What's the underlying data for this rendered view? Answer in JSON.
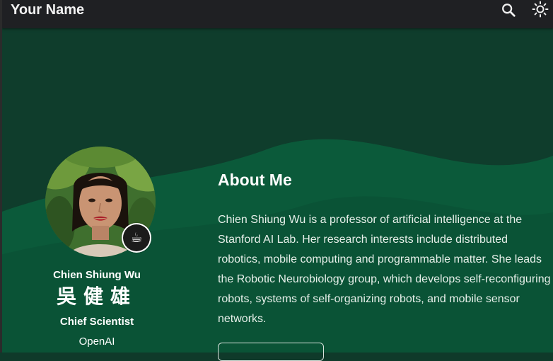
{
  "header": {
    "brand": "Your Name",
    "search_icon": "search-icon",
    "theme_icon": "sun-icon"
  },
  "profile": {
    "name_en": "Chien Shiung Wu",
    "name_cn": "吳健雄",
    "role": "Chief Scientist",
    "organization": "OpenAI",
    "status_icon": "coffee-cup-icon",
    "status_emoji": "☕"
  },
  "about": {
    "title": "About Me",
    "bio": "Chien Shiung Wu is a professor of artificial intelligence at the Stanford AI Lab. Her research interests include distributed robotics, mobile computing and programmable matter. She leads the Robotic Neurobiology group, which develops self-reconfiguring robots, systems of self-organizing robots, and mobile sensor networks."
  },
  "colors": {
    "background": "#0f3a2a",
    "wave": "#0b5b3a",
    "topbar": "#1f2023"
  }
}
